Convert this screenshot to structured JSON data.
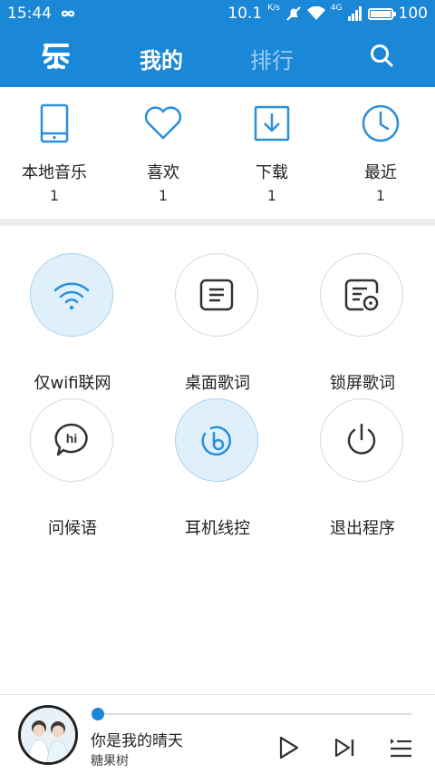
{
  "status_bar": {
    "time": "15:44",
    "speed": "10.1",
    "speed_unit": "K/s",
    "network": "4G",
    "battery": "100",
    "battery_level": 1.0
  },
  "header": {
    "logo_icon": "music-logo-icon",
    "tabs": [
      {
        "label": "我的",
        "active": true
      },
      {
        "label": "排行",
        "active": false
      }
    ],
    "search_icon": "search-icon"
  },
  "shortcuts": [
    {
      "label": "本地音乐",
      "count": "1",
      "icon": "phone-icon"
    },
    {
      "label": "喜欢",
      "count": "1",
      "icon": "heart-icon"
    },
    {
      "label": "下载",
      "count": "1",
      "icon": "download-icon"
    },
    {
      "label": "最近",
      "count": "1",
      "icon": "clock-icon"
    }
  ],
  "tools": [
    {
      "label": "仅wifi联网",
      "icon": "wifi-icon",
      "active": true
    },
    {
      "label": "桌面歌词",
      "icon": "lyrics-icon",
      "active": false
    },
    {
      "label": "锁屏歌词",
      "icon": "lockscreen-lyrics-icon",
      "active": false
    },
    {
      "label": "问候语",
      "icon": "greeting-hi-icon",
      "active": false
    },
    {
      "label": "耳机线控",
      "icon": "headset-control-icon",
      "active": true
    },
    {
      "label": "退出程序",
      "icon": "power-icon",
      "active": false
    }
  ],
  "player": {
    "song": "你是我的晴天",
    "artist": "糖果树",
    "progress": 0.01,
    "accent": "#1a88d6"
  },
  "colors": {
    "primary": "#1a88d6",
    "icon_blue": "#2b8fd8",
    "active_circle": "#dff0fb"
  }
}
